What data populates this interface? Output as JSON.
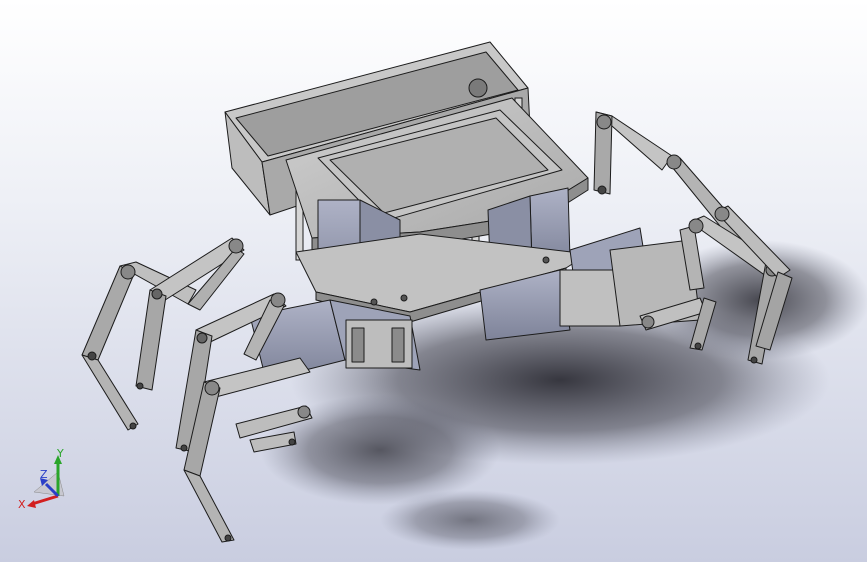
{
  "viewport": {
    "background_top": "#ffffff",
    "background_bottom": "#c9cde0"
  },
  "model": {
    "part_color": "#b9b9b9",
    "servo_color": "#9a9fb3",
    "edge_color": "#1c1c1c",
    "shadow_color": "#3a3a42"
  },
  "triad": {
    "x_label": "X",
    "y_label": "Y",
    "z_label": "Z",
    "x_color": "#d21f1f",
    "y_color": "#2aa52a",
    "z_color": "#2a3fc8"
  }
}
